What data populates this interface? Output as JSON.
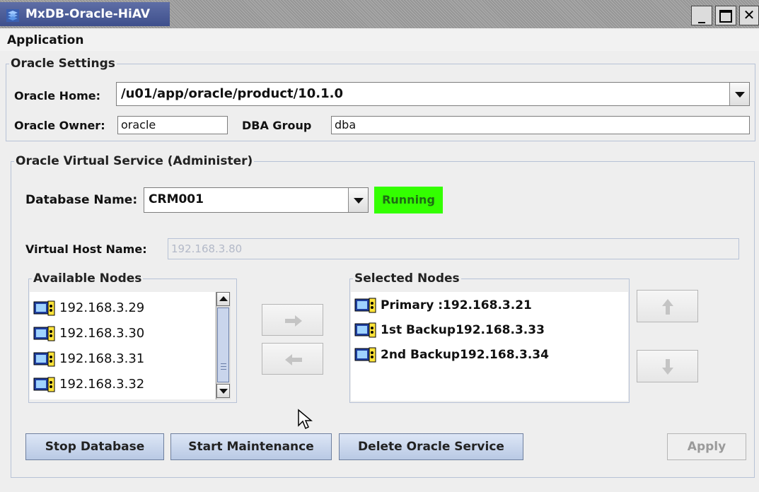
{
  "window": {
    "title": "MxDB-Oracle-HiAV",
    "controls": [
      "minimize",
      "maximize",
      "close"
    ]
  },
  "menu": {
    "items": [
      "Application"
    ]
  },
  "oracle_settings": {
    "legend": "Oracle Settings",
    "home_label": "Oracle Home:",
    "home_value": "/u01/app/oracle/product/10.1.0",
    "owner_label": "Oracle Owner:",
    "owner_value": "oracle",
    "dba_label": "DBA Group",
    "dba_value": "dba"
  },
  "virtual_service": {
    "legend": "Oracle Virtual Service (Administer)",
    "db_label": "Database Name:",
    "db_value": "CRM001",
    "status": "Running",
    "status_color": "#33ff00",
    "vhost_label": "Virtual Host Name:",
    "vhost_value": "192.168.3.80",
    "available_legend": "Available Nodes",
    "available_nodes": [
      "192.168.3.29",
      "192.168.3.30",
      "192.168.3.31",
      "192.168.3.32"
    ],
    "selected_legend": "Selected Nodes",
    "selected_nodes": [
      "Primary :192.168.3.21",
      "1st Backup192.168.3.33",
      "2nd Backup192.168.3.34"
    ],
    "icons": {
      "add": "arrow-right-icon",
      "remove": "arrow-left-icon",
      "up": "arrow-up-icon",
      "down": "arrow-down-icon",
      "node": "node-server-icon"
    }
  },
  "buttons": {
    "stop": "Stop Database",
    "maintenance": "Start Maintenance",
    "delete": "Delete Oracle Service",
    "apply": "Apply"
  }
}
